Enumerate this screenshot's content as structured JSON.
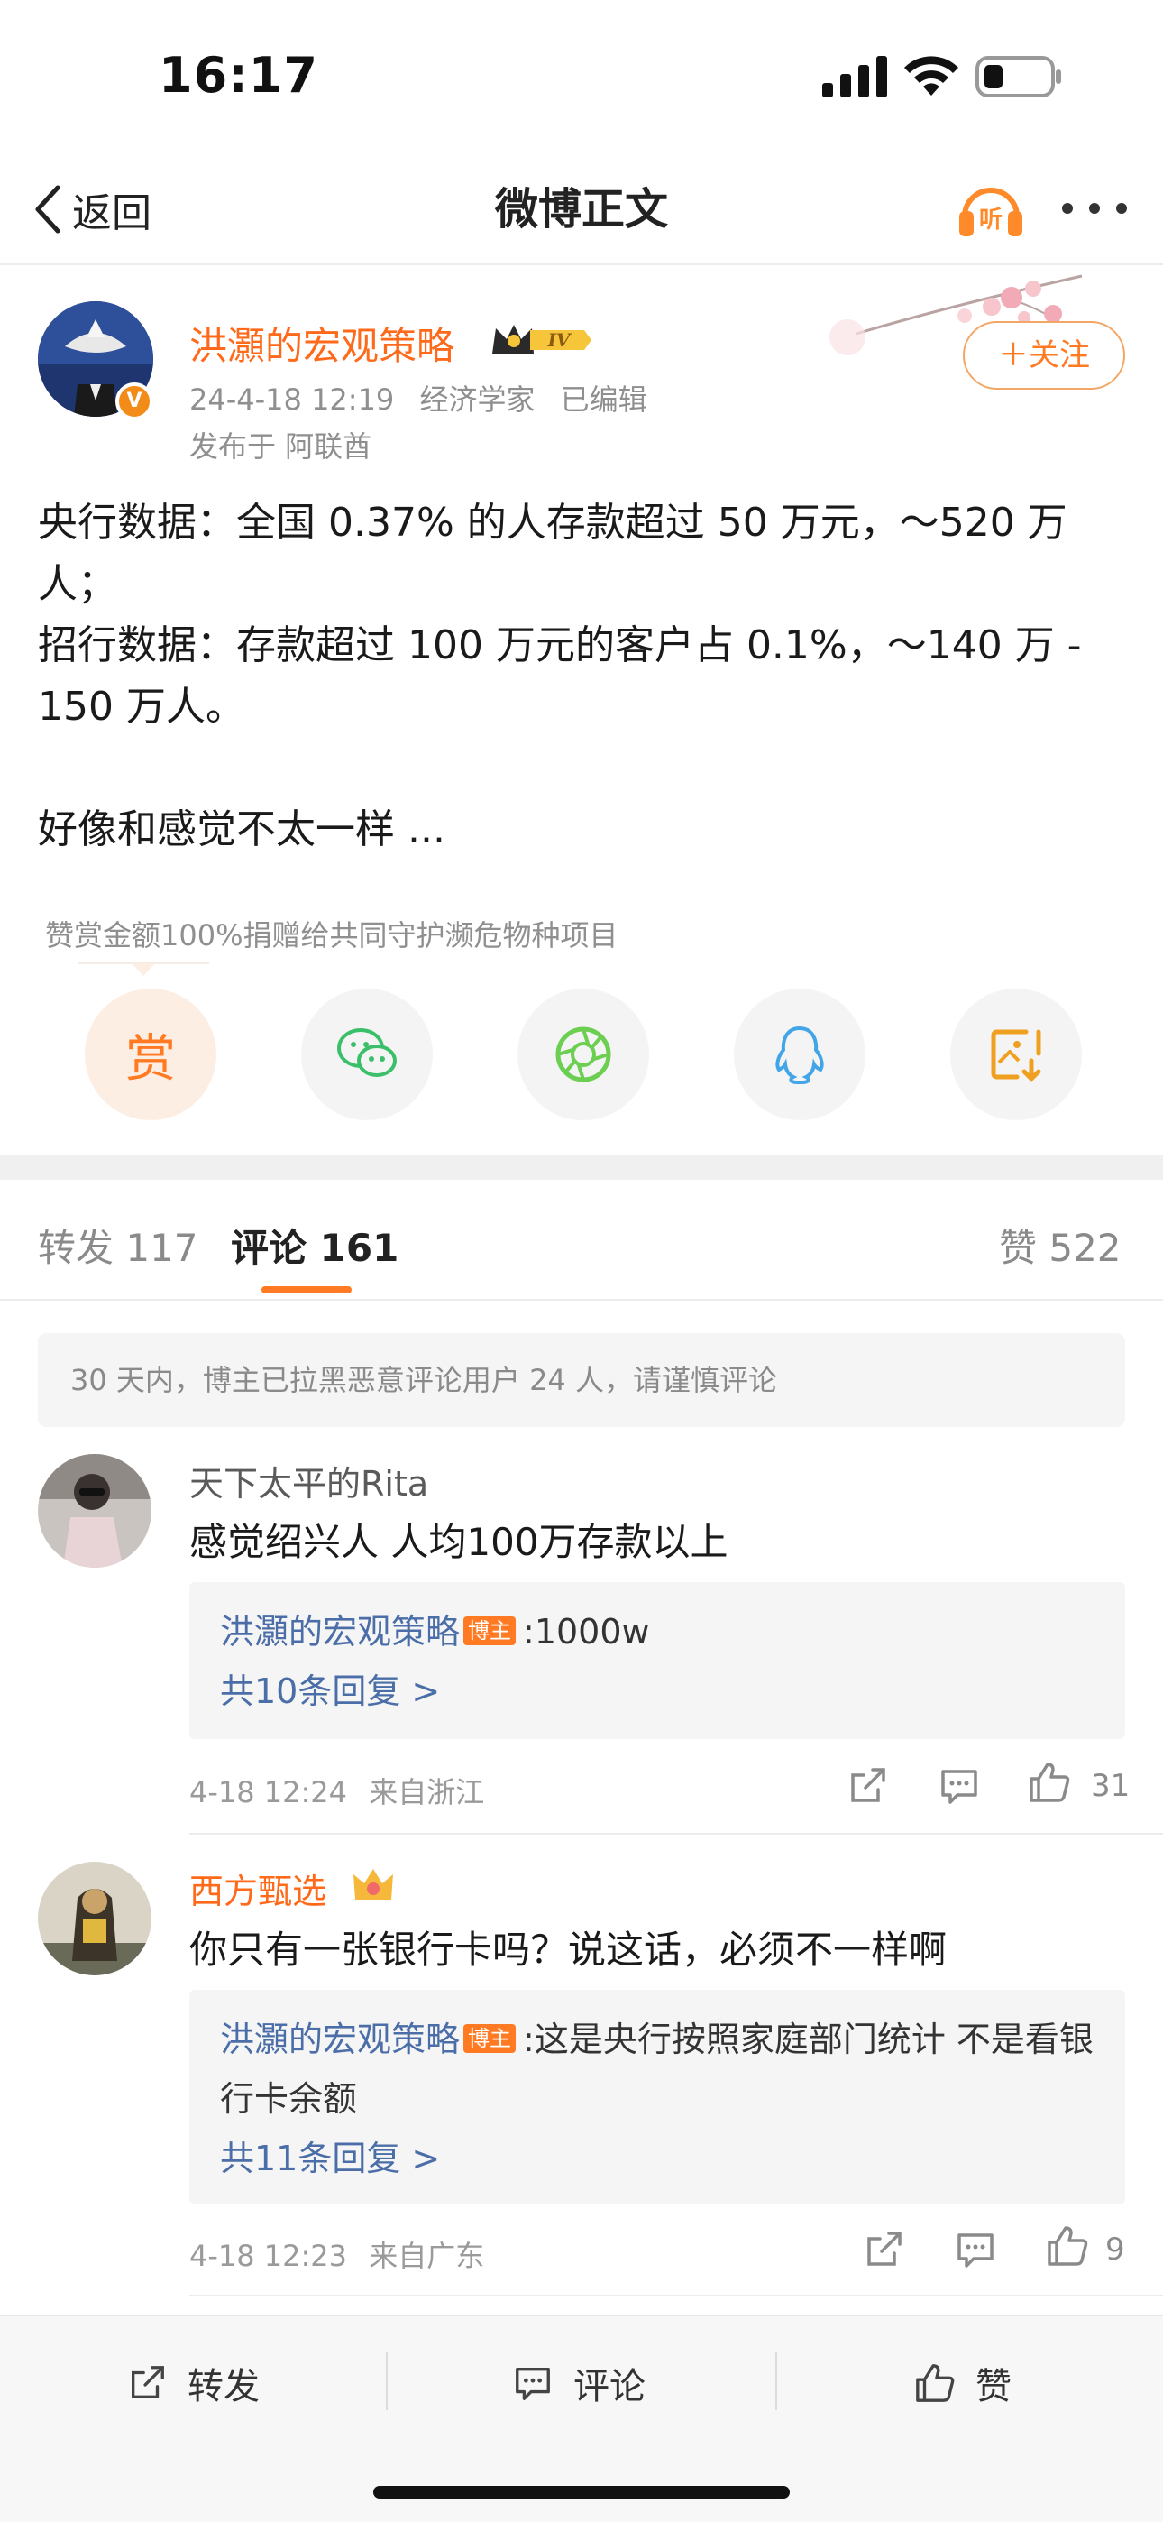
{
  "status": {
    "time": "16:17"
  },
  "nav": {
    "back_label": "返回",
    "title": "微博正文"
  },
  "post": {
    "author": "洪灝的宏观策略",
    "verified_badge": "V",
    "date": "24-4-18 12:19",
    "role": "经济学家",
    "edited": "已编辑",
    "published_from": "发布于 阿联酋",
    "follow_label": "＋关注",
    "content": [
      "央行数据：全国 0.37% 的人存款超过 50 万元，～520 万",
      "人；",
      "招行数据：存款超过 100 万元的客户占 0.1%，～140 万 -",
      "150 万人。",
      "",
      "好像和感觉不太一样 ..."
    ],
    "reward_text": "赞赏金额100%捐赠给共同守护濒危物种项目",
    "reward_button": "赏"
  },
  "tabs": {
    "repost": "转发 117",
    "comment": "评论 161",
    "likes": "赞 522"
  },
  "notice": "30 天内，博主已拉黑恶意评论用户 24 人，请谨慎评论",
  "comments": [
    {
      "name": "天下太平的Rita",
      "text": "感觉绍兴人 人均100万存款以上",
      "reply_author": "洪灝的宏观策略",
      "owner_tag": "博主",
      "reply_text": ":1000w",
      "reply_more": "共10条回复 >",
      "date": "4-18 12:24",
      "location": "来自浙江",
      "likes": "31"
    },
    {
      "name": "西方甄选",
      "text": "你只有一张银行卡吗？说这话，必须不一样啊",
      "reply_author": "洪灝的宏观策略",
      "owner_tag": "博主",
      "reply_text": ":这是央行按照家庭部门统计 不是看银行卡余额",
      "reply_more": "共11条回复 >",
      "date": "4-18 12:23",
      "location": "来自广东",
      "likes": "9"
    }
  ],
  "bottom_bar": {
    "repost": "转发",
    "comment": "评论",
    "like": "赞"
  },
  "colors": {
    "accent": "#ff7a22",
    "link": "#4b6ea8",
    "author": "#ff6a1a"
  }
}
